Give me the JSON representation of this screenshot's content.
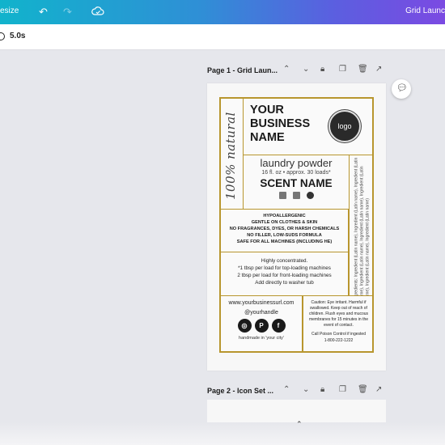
{
  "topbar": {
    "resize_label": "esize",
    "undo_icon": "undo-icon",
    "redo_icon": "redo-icon",
    "cloud_icon": "cloud-saved-icon",
    "doc_title": "Grid Launc"
  },
  "subbar": {
    "timer": "5.0s"
  },
  "pages": [
    {
      "header": "Page 1 - Grid Laun..."
    },
    {
      "header": "Page 2 - Icon Set ..."
    }
  ],
  "label": {
    "script_text": "100% natural",
    "business_name_line1": "YOUR",
    "business_name_line2": "BUSINESS",
    "business_name_line3": "NAME",
    "logo": "logo",
    "product": "laundry powder",
    "size": "16 fl. oz • approx. 30 loads*",
    "scent": "SCENT NAME",
    "claims": [
      "HYPOALLERGENIC",
      "GENTLE ON CLOTHES & SKIN",
      "NO FRAGRANCES, DYES, OR HARSH CHEMICALS",
      "NO FILLER, LOW-SUDS FORMULA",
      "SAFE FOR ALL MACHINES (INCLUDING HE)"
    ],
    "usage": [
      "Highly concentrated.",
      "*1 tbsp per load for top-loading machines",
      "2 tbsp per load for front-loading machines",
      "Add directly to washer tub"
    ],
    "ingredients": "Ingredients: Ingredient (Latin name), Ingredient (Latin name), Ingredient (Latin name), Ingredient (Latin name), Ingredient (Latin name), Ingredient (Latin name), Ingredient (Latin name), Ingredient (Latin name)",
    "url": "www.yourbusinessurl.com",
    "handle": "@yourhandle",
    "social": [
      "instagram-icon",
      "pinterest-icon",
      "facebook-icon"
    ],
    "city": "handmade in 'your city'",
    "caution": "Caution: Eye irritant. Harmful if swallowed. Keep out of reach of children. Flush eyes and mucous membranes for 15 minutes in the event of contact.",
    "poison_control": "Call Poison Control if ingested",
    "phone": "1-800-222-1222"
  },
  "colors": {
    "gold": "#b8962e",
    "logo_bg": "#2a2a2a"
  }
}
